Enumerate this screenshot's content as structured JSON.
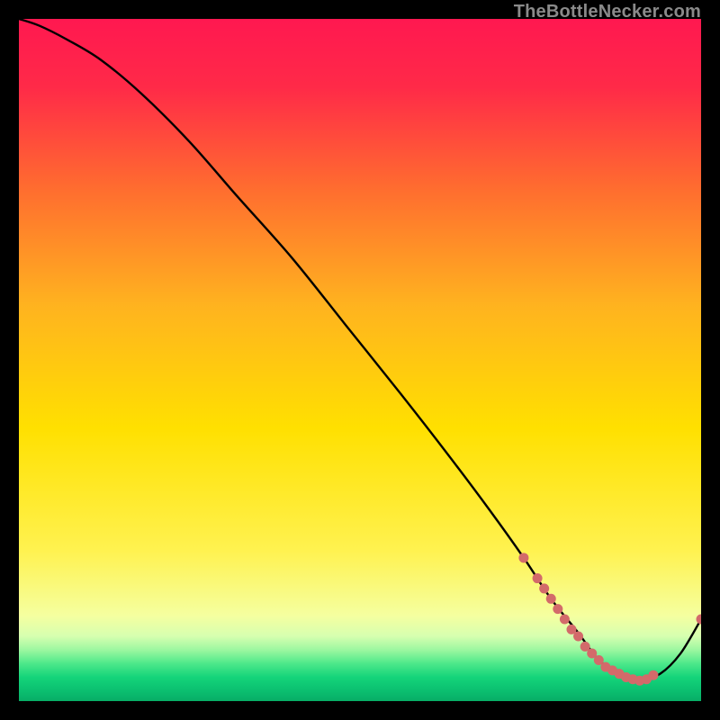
{
  "watermark": "TheBottleNecker.com",
  "chart_data": {
    "type": "line",
    "title": "",
    "xlabel": "",
    "ylabel": "",
    "xlim": [
      0,
      100
    ],
    "ylim": [
      0,
      100
    ],
    "grid": false,
    "background": {
      "top_color": "#ff1744",
      "mid_color": "#ffe000",
      "low_color": "#00e676",
      "black_border": true
    },
    "series": [
      {
        "name": "curve",
        "stroke": "#000000",
        "x": [
          0,
          3,
          7,
          12,
          18,
          25,
          32,
          40,
          48,
          56,
          63,
          69,
          74,
          78,
          82,
          85,
          88,
          91,
          94,
          97,
          100
        ],
        "y": [
          100,
          99,
          97,
          94,
          89,
          82,
          74,
          65,
          55,
          45,
          36,
          28,
          21,
          15,
          10,
          6,
          4,
          3,
          4,
          7,
          12
        ]
      }
    ],
    "scatter": {
      "name": "points",
      "color": "#d36a6a",
      "radius": 5.5,
      "x": [
        74,
        76,
        77,
        78,
        79,
        80,
        81,
        82,
        83,
        84,
        85,
        86,
        87,
        88,
        89,
        90,
        91,
        92,
        93,
        100
      ],
      "y": [
        21,
        18,
        16.5,
        15,
        13.5,
        12,
        10.5,
        9.5,
        8,
        7,
        6,
        5,
        4.5,
        4,
        3.5,
        3.2,
        3,
        3.2,
        3.8,
        12
      ]
    }
  }
}
